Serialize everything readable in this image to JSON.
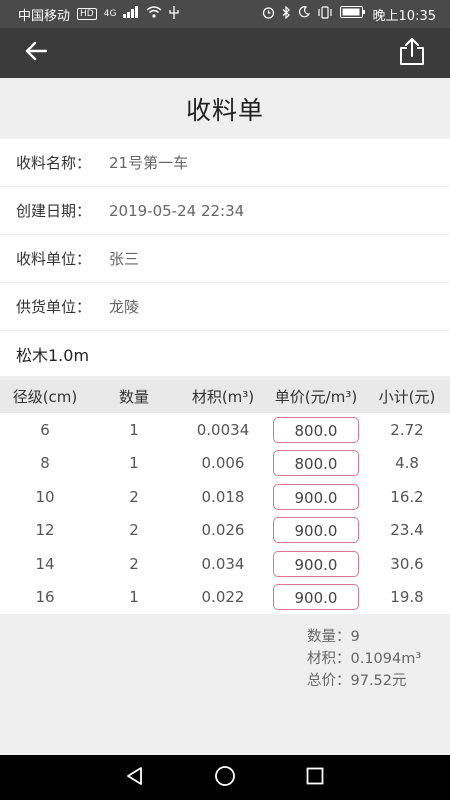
{
  "statusbar": {
    "carrier": "中国移动",
    "hd_badge": "HD",
    "network": "4G",
    "time": "晚上10:35"
  },
  "appbar": {
    "back_icon": "arrow-left-icon",
    "share_icon": "share-icon"
  },
  "page": {
    "title": "收料单"
  },
  "info": [
    {
      "label": "收料名称：",
      "value": "21号第一车"
    },
    {
      "label": "创建日期：",
      "value": "2019-05-24 22:34"
    },
    {
      "label": "收料单位：",
      "value": "张三"
    },
    {
      "label": "供货单位：",
      "value": "龙陵"
    }
  ],
  "section": {
    "title": "松木1.0m"
  },
  "table": {
    "headers": [
      "径级(cm)",
      "数量",
      "材积(m³)",
      "单价(元/m³)",
      "小计(元)"
    ],
    "rows": [
      {
        "diameter": "6",
        "qty": "1",
        "volume": "0.0034",
        "price": "800.0",
        "subtotal": "2.72"
      },
      {
        "diameter": "8",
        "qty": "1",
        "volume": "0.006",
        "price": "800.0",
        "subtotal": "4.8"
      },
      {
        "diameter": "10",
        "qty": "2",
        "volume": "0.018",
        "price": "900.0",
        "subtotal": "16.2"
      },
      {
        "diameter": "12",
        "qty": "2",
        "volume": "0.026",
        "price": "900.0",
        "subtotal": "23.4"
      },
      {
        "diameter": "14",
        "qty": "2",
        "volume": "0.034",
        "price": "900.0",
        "subtotal": "30.6"
      },
      {
        "diameter": "16",
        "qty": "1",
        "volume": "0.022",
        "price": "900.0",
        "subtotal": "19.8"
      }
    ]
  },
  "summary": {
    "count": "数量：9",
    "volume": "材积：0.1094m³",
    "total": "总价：97.52元"
  },
  "navbar": {
    "back": "nav-back-icon",
    "home": "nav-home-icon",
    "recents": "nav-recents-icon"
  },
  "colors": {
    "appbar": "#3b3b3b",
    "statusbar": "#4a4a4a",
    "price_border": "#d9778f"
  }
}
